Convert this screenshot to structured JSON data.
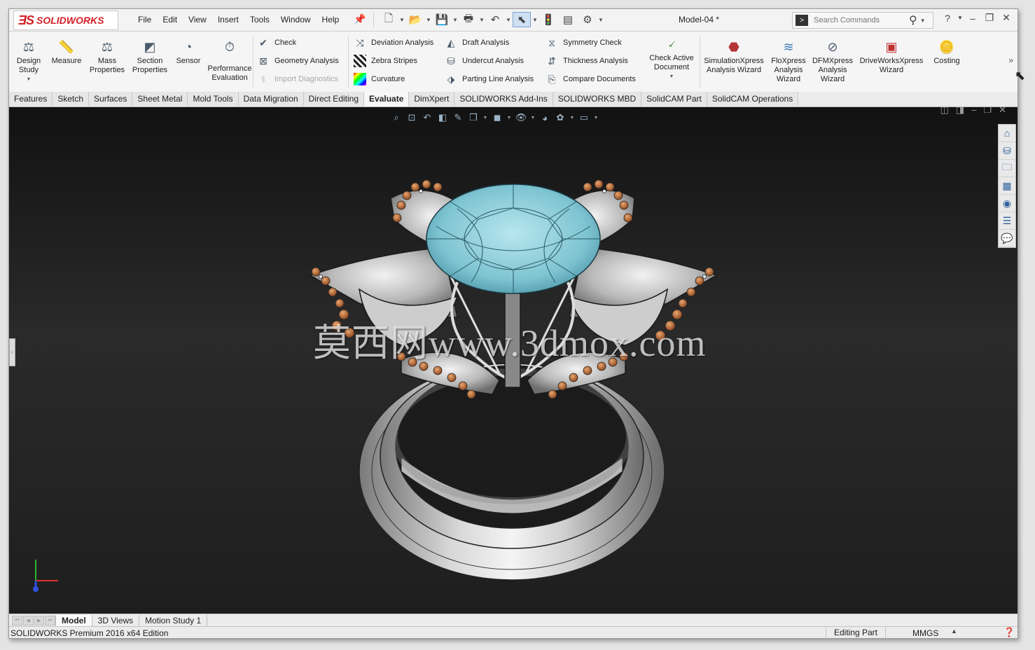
{
  "app": {
    "logo_text": "SOLIDWORKS",
    "document_title": "Model-04 *"
  },
  "menu": [
    "File",
    "Edit",
    "View",
    "Insert",
    "Tools",
    "Window",
    "Help"
  ],
  "search": {
    "placeholder": "Search Commands"
  },
  "ribbon": {
    "design_study": "Design Study",
    "measure": "Measure",
    "mass_properties": "Mass Properties",
    "section_properties": "Section Properties",
    "sensor": "Sensor",
    "performance_evaluation": "Performance Evaluation",
    "check": "Check",
    "geometry_analysis": "Geometry Analysis",
    "import_diagnostics": "Import Diagnostics",
    "deviation_analysis": "Deviation Analysis",
    "zebra_stripes": "Zebra Stripes",
    "curvature": "Curvature",
    "draft_analysis": "Draft Analysis",
    "undercut_analysis": "Undercut Analysis",
    "parting_line_analysis": "Parting Line Analysis",
    "symmetry_check": "Symmetry Check",
    "thickness_analysis": "Thickness Analysis",
    "compare_documents": "Compare Documents",
    "check_active_document": "Check Active Document",
    "simulationxpress": "SimulationXpress Analysis Wizard",
    "floxpress": "FloXpress Analysis Wizard",
    "dfmxpress": "DFMXpress Analysis Wizard",
    "driveworksxpress": "DriveWorksXpress Wizard",
    "costing": "Costing"
  },
  "tabs": [
    "Features",
    "Sketch",
    "Surfaces",
    "Sheet Metal",
    "Mold Tools",
    "Data Migration",
    "Direct Editing",
    "Evaluate",
    "DimXpert",
    "SOLIDWORKS Add-Ins",
    "SOLIDWORKS MBD",
    "SolidCAM Part",
    "SolidCAM Operations"
  ],
  "active_tab": "Evaluate",
  "viewport": {
    "watermark": "莫西网www.3dmox.com"
  },
  "bottom_tabs": [
    "Model",
    "3D Views",
    "Motion Study 1"
  ],
  "status": {
    "edition": "SOLIDWORKS Premium 2016 x64 Edition",
    "mode": "Editing Part",
    "units": "MMGS"
  },
  "colors": {
    "brand_red": "#d42027",
    "gem_blue": "#7fc4d2",
    "stone_orange": "#b5652e",
    "metal_silver": "#c8c8c8"
  }
}
